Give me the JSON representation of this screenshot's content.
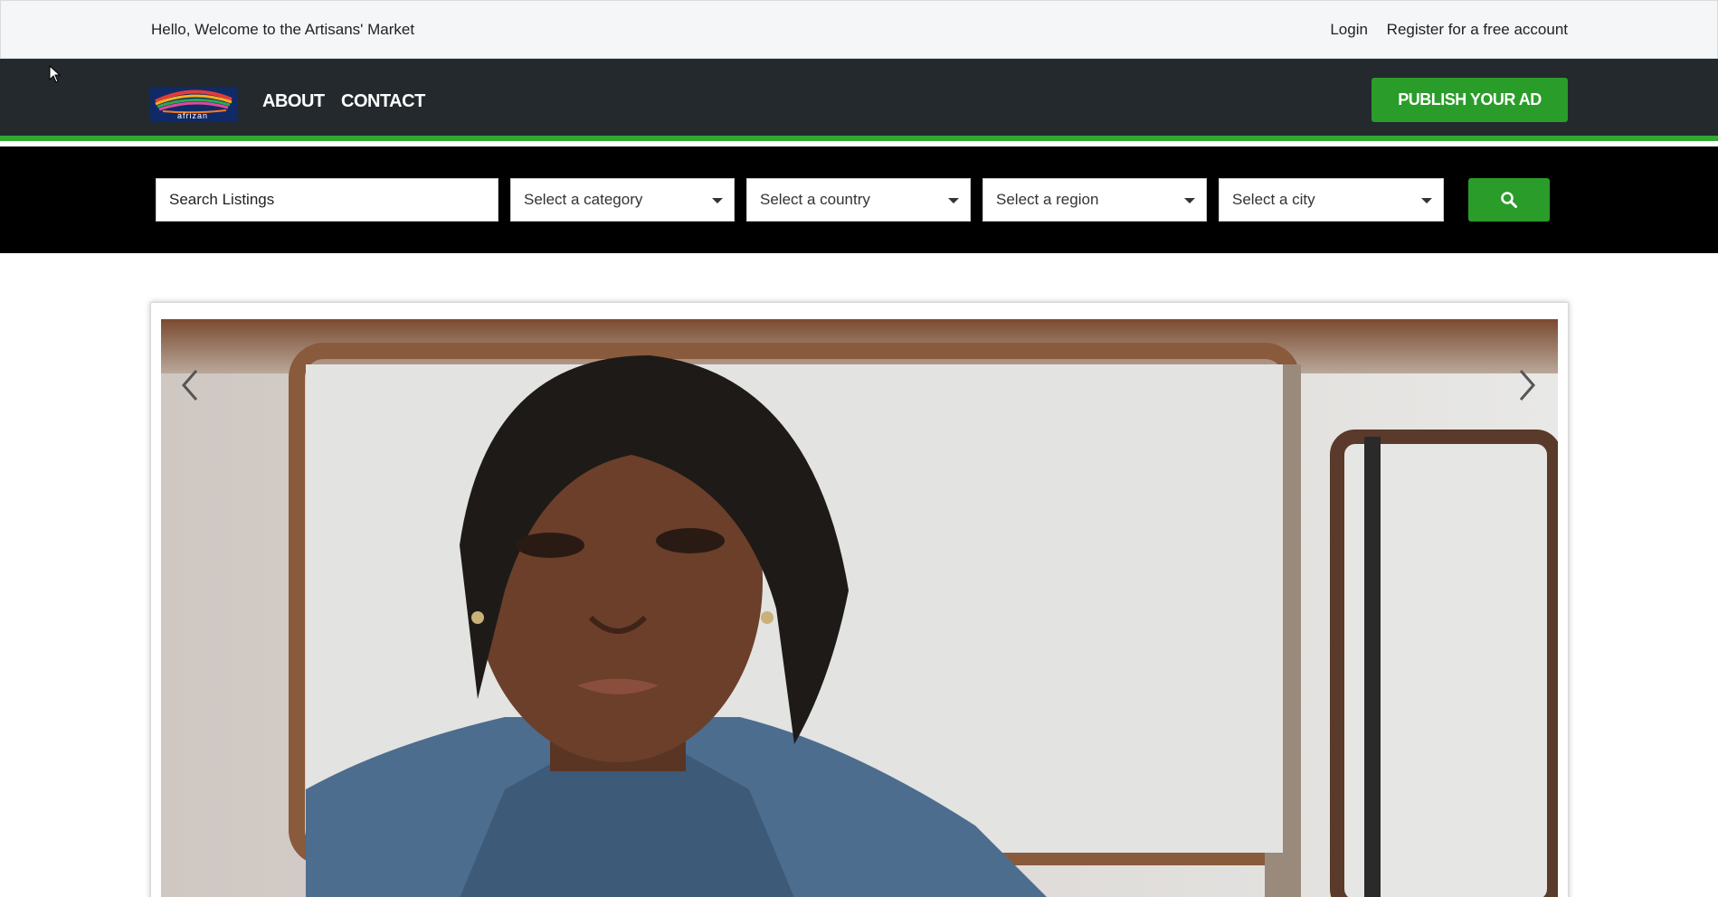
{
  "topbar": {
    "welcome": "Hello, Welcome to the Artisans' Market",
    "login": "Login",
    "register": "Register for a free account"
  },
  "nav": {
    "logo_text": "afrizan",
    "logo_icon": "brand-logo",
    "about": "ABOUT",
    "contact": "CONTACT",
    "publish": "PUBLISH YOUR AD"
  },
  "search": {
    "placeholder": "Search Listings",
    "category": "Select a category",
    "country": "Select a country",
    "region": "Select a region",
    "city": "Select a city",
    "button_icon": "search-icon"
  },
  "carousel": {
    "prev_icon": "chevron-left-icon",
    "next_icon": "chevron-right-icon",
    "slide_image": "portrait-photo"
  },
  "colors": {
    "brand_green": "#2a9c2a",
    "nav_dark": "#23292d",
    "search_bg": "#000000",
    "topbar_bg": "#f4f6f8"
  }
}
